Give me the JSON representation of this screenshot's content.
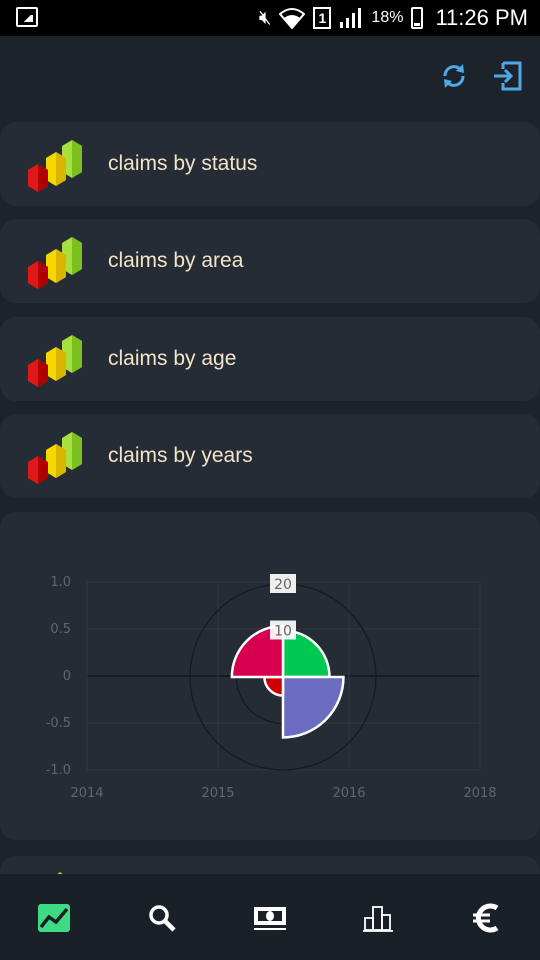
{
  "status_bar": {
    "battery": "18%",
    "time": "11:26 PM",
    "sim": "1"
  },
  "menu": [
    {
      "label": "claims by status"
    },
    {
      "label": "claims by area"
    },
    {
      "label": "claims by age"
    },
    {
      "label": "claims by years"
    }
  ],
  "bottom_nav": [
    {
      "icon": "trend-chart-icon",
      "active": true
    },
    {
      "icon": "search-icon",
      "active": false
    },
    {
      "icon": "banknote-icon",
      "active": false
    },
    {
      "icon": "bar-chart-icon",
      "active": false
    },
    {
      "icon": "euro-icon",
      "active": false
    }
  ],
  "chart_data": {
    "type": "polar-area",
    "x_ticks": [
      "2014",
      "2015",
      "2016",
      "2018"
    ],
    "y_ticks": [
      "1.0",
      "0.5",
      "0",
      "-0.5",
      "-1.0"
    ],
    "r_ticks": [
      "10",
      "20"
    ],
    "r_max": 20,
    "segments": [
      {
        "color": "#00c853",
        "value": 10
      },
      {
        "color": "#6b6bc0",
        "value": 13
      },
      {
        "color": "#cc0000",
        "value": 4
      },
      {
        "color": "#d6004f",
        "value": 11
      }
    ]
  }
}
